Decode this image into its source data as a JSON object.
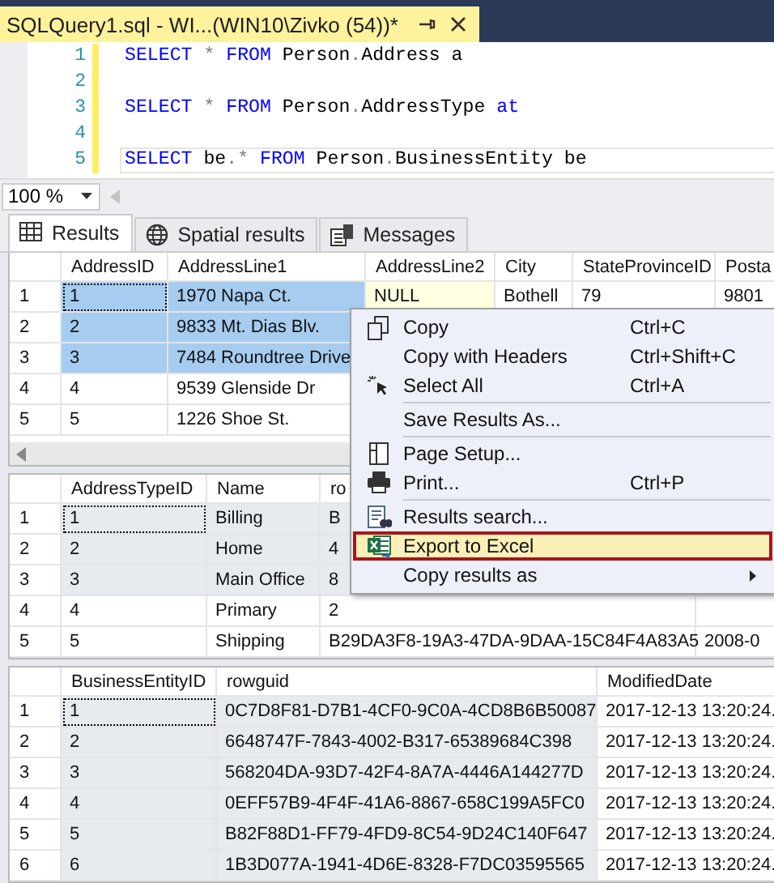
{
  "document_tab": {
    "title": "SQLQuery1.sql - WI...(WIN10\\Zivko (54))*"
  },
  "editor": {
    "lines": [
      {
        "number": "1",
        "changed": true,
        "current": false,
        "tokens": [
          {
            "kind": "keyword",
            "text": "SELECT"
          },
          {
            "kind": "operator",
            "text": " * "
          },
          {
            "kind": "keyword",
            "text": "FROM"
          },
          {
            "kind": "plain",
            "text": " Person"
          },
          {
            "kind": "operator",
            "text": "."
          },
          {
            "kind": "plain",
            "text": "Address a"
          }
        ]
      },
      {
        "number": "2",
        "changed": true,
        "current": false
      },
      {
        "number": "3",
        "changed": true,
        "current": false,
        "tokens": [
          {
            "kind": "keyword",
            "text": "SELECT"
          },
          {
            "kind": "operator",
            "text": " * "
          },
          {
            "kind": "keyword",
            "text": "FROM"
          },
          {
            "kind": "plain",
            "text": " Person"
          },
          {
            "kind": "operator",
            "text": "."
          },
          {
            "kind": "plain",
            "text": "AddressType "
          },
          {
            "kind": "keyword",
            "text": "at"
          }
        ]
      },
      {
        "number": "4",
        "changed": true,
        "current": false
      },
      {
        "number": "5",
        "changed": true,
        "current": true,
        "tokens": [
          {
            "kind": "keyword",
            "text": "SELECT"
          },
          {
            "kind": "plain",
            "text": " be"
          },
          {
            "kind": "operator",
            "text": ".*"
          },
          {
            "kind": "keyword",
            "text": " FROM"
          },
          {
            "kind": "plain",
            "text": " Person"
          },
          {
            "kind": "operator",
            "text": "."
          },
          {
            "kind": "plain",
            "text": "BusinessEntity be"
          }
        ]
      }
    ]
  },
  "zoom": {
    "value": "100 %"
  },
  "result_tabs": [
    {
      "label": "Results",
      "selected": true
    },
    {
      "label": "Spatial results",
      "selected": false
    },
    {
      "label": "Messages",
      "selected": false
    }
  ],
  "grids": [
    {
      "active": true,
      "horizontal_scrollbar": true,
      "columns": [
        {
          "label": "AddressID",
          "selected": true
        },
        {
          "label": "AddressLine1",
          "selected": true
        },
        {
          "label": "AddressLine2",
          "selected": false
        },
        {
          "label": "City",
          "selected": false
        },
        {
          "label": "StateProvinceID",
          "selected": false
        },
        {
          "label": "Posta",
          "selected": false
        }
      ],
      "rows": [
        {
          "number": "1",
          "selected": true,
          "focused": true,
          "cells": [
            "1",
            "1970 Napa Ct.",
            {
              "text": "NULL",
              "null": true
            },
            "Bothell",
            "79",
            "9801"
          ]
        },
        {
          "number": "2",
          "selected": true,
          "focused": false,
          "cells": [
            "2",
            "9833 Mt. Dias Blv."
          ]
        },
        {
          "number": "3",
          "selected": true,
          "focused": false,
          "cells": [
            "3",
            "7484 Roundtree Drive"
          ]
        },
        {
          "number": "4",
          "selected": false,
          "focused": false,
          "cells": [
            "4",
            "9539 Glenside Dr"
          ]
        },
        {
          "number": "5",
          "selected": false,
          "focused": false,
          "cells": [
            "5",
            "1226 Shoe St."
          ]
        }
      ]
    },
    {
      "active": false,
      "horizontal_scrollbar": false,
      "columns": [
        {
          "label": "AddressTypeID",
          "selected": true
        },
        {
          "label": "Name",
          "selected": true
        },
        {
          "label": "ro",
          "selected": true
        }
      ],
      "rows": [
        {
          "number": "1",
          "selected": true,
          "focused": true,
          "cells": [
            "1",
            "Billing",
            "B"
          ]
        },
        {
          "number": "2",
          "selected": true,
          "focused": false,
          "cells": [
            "2",
            "Home",
            "4"
          ]
        },
        {
          "number": "3",
          "selected": true,
          "focused": false,
          "cells": [
            "3",
            "Main Office",
            "8"
          ]
        },
        {
          "number": "4",
          "selected": false,
          "focused": false,
          "cells": [
            "4",
            "Primary",
            "2"
          ]
        },
        {
          "number": "5",
          "selected": false,
          "focused": false,
          "cells": [
            "5",
            "Shipping",
            "B29DA3F8-19A3-47DA-9DAA-15C84F4A83A5",
            "2008-0"
          ]
        }
      ]
    },
    {
      "active": false,
      "horizontal_scrollbar": false,
      "columns": [
        {
          "label": "BusinessEntityID",
          "selected": true
        },
        {
          "label": "rowguid",
          "selected": true
        },
        {
          "label": "ModifiedDate",
          "selected": false
        }
      ],
      "rows": [
        {
          "number": "1",
          "selected": true,
          "focused": true,
          "cells": [
            "1",
            "0C7D8F81-D7B1-4CF0-9C0A-4CD8B6B50087",
            "2017-12-13 13:20:24."
          ]
        },
        {
          "number": "2",
          "selected": true,
          "focused": false,
          "cells": [
            "2",
            "6648747F-7843-4002-B317-65389684C398",
            "2017-12-13 13:20:24."
          ]
        },
        {
          "number": "3",
          "selected": true,
          "focused": false,
          "cells": [
            "3",
            "568204DA-93D7-42F4-8A7A-4446A144277D",
            "2017-12-13 13:20:24."
          ]
        },
        {
          "number": "4",
          "selected": true,
          "focused": false,
          "cells": [
            "4",
            "0EFF57B9-4F4F-41A6-8867-658C199A5FC0",
            "2017-12-13 13:20:24."
          ]
        },
        {
          "number": "5",
          "selected": true,
          "focused": false,
          "cells": [
            "5",
            "B82F88D1-FF79-4FD9-8C54-9D24C140F647",
            "2017-12-13 13:20:24."
          ]
        },
        {
          "number": "6",
          "selected": true,
          "focused": false,
          "cells": [
            "6",
            "1B3D077A-1941-4D6E-8328-F7DC03595565",
            "2017-12-13 13:20:24."
          ]
        }
      ]
    }
  ],
  "context_menu": {
    "items": [
      {
        "kind": "item",
        "label": "Copy",
        "shortcut": "Ctrl+C",
        "highlighted": false,
        "submenu": false
      },
      {
        "kind": "item",
        "label": "Copy with Headers",
        "shortcut": "Ctrl+Shift+C",
        "highlighted": false,
        "submenu": false
      },
      {
        "kind": "item",
        "label": "Select All",
        "shortcut": "Ctrl+A",
        "highlighted": false,
        "submenu": false
      },
      {
        "kind": "separator"
      },
      {
        "kind": "item",
        "label": "Save Results As...",
        "highlighted": false,
        "submenu": false
      },
      {
        "kind": "separator"
      },
      {
        "kind": "item",
        "label": "Page Setup...",
        "highlighted": false,
        "submenu": false
      },
      {
        "kind": "item",
        "label": "Print...",
        "shortcut": "Ctrl+P",
        "highlighted": false,
        "submenu": false
      },
      {
        "kind": "separator"
      },
      {
        "kind": "item",
        "label": "Results search...",
        "highlighted": false,
        "submenu": false
      },
      {
        "kind": "item",
        "label": "Export to Excel",
        "highlighted": true,
        "submenu": false
      },
      {
        "kind": "item",
        "label": "Copy results as",
        "highlighted": false,
        "submenu": true
      }
    ]
  }
}
